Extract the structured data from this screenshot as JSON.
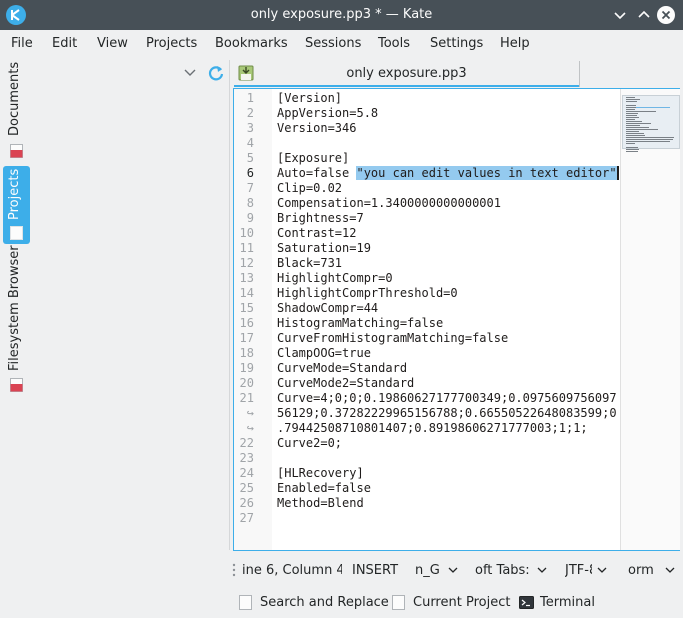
{
  "window": {
    "title": "only exposure.pp3 * — Kate"
  },
  "menu": [
    "File",
    "Edit",
    "View",
    "Projects",
    "Bookmarks",
    "Sessions",
    "Tools",
    "Settings",
    "Help"
  ],
  "sidebar": {
    "tabs": [
      {
        "label": "Documents",
        "icon": "document-icon",
        "active": false
      },
      {
        "label": "Projects",
        "icon": "project-icon",
        "active": true
      },
      {
        "label": "Filesystem Browser",
        "icon": "folder-icon",
        "active": false
      }
    ]
  },
  "document_tab": {
    "label": "only exposure.pp3",
    "icon": "save-icon"
  },
  "editor": {
    "current_line": "6",
    "lines": [
      {
        "no": "1",
        "text": "[Version]"
      },
      {
        "no": "2",
        "text": "AppVersion=5.8"
      },
      {
        "no": "3",
        "text": "Version=346"
      },
      {
        "no": "4",
        "text": ""
      },
      {
        "no": "5",
        "text": "[Exposure]"
      },
      {
        "no": "6",
        "text": "Auto=false ",
        "selected": "\"you can edit values in text editor\""
      },
      {
        "no": "7",
        "text": "Clip=0.02"
      },
      {
        "no": "8",
        "text": "Compensation=1.3400000000000001"
      },
      {
        "no": "9",
        "text": "Brightness=7"
      },
      {
        "no": "10",
        "text": "Contrast=12"
      },
      {
        "no": "11",
        "text": "Saturation=19"
      },
      {
        "no": "12",
        "text": "Black=731"
      },
      {
        "no": "13",
        "text": "HighlightCompr=0"
      },
      {
        "no": "14",
        "text": "HighlightComprThreshold=0"
      },
      {
        "no": "15",
        "text": "ShadowCompr=44"
      },
      {
        "no": "16",
        "text": "HistogramMatching=false"
      },
      {
        "no": "17",
        "text": "CurveFromHistogramMatching=false"
      },
      {
        "no": "18",
        "text": "ClampOOG=true"
      },
      {
        "no": "19",
        "text": "CurveMode=Standard"
      },
      {
        "no": "20",
        "text": "CurveMode2=Standard"
      },
      {
        "no": "21",
        "text": "Curve=4;0;0;0.19860627177700349;0.0975609756097"
      },
      {
        "no": "↪",
        "text": "56129;0.37282229965156788;0.66550522648083599;0"
      },
      {
        "no": "↪",
        "text": ".79442508710801407;0.89198606271777003;1;1;"
      },
      {
        "no": "22",
        "text": "Curve2=0;"
      },
      {
        "no": "23",
        "text": ""
      },
      {
        "no": "24",
        "text": "[HLRecovery]"
      },
      {
        "no": "25",
        "text": "Enabled=false"
      },
      {
        "no": "26",
        "text": "Method=Blend"
      },
      {
        "no": "27",
        "text": ""
      }
    ]
  },
  "statusbar": {
    "position": "ine 6, Column 4",
    "mode": "INSERT",
    "dictionary": "n_G",
    "indent": "oft Tabs:",
    "encoding": "JTF-8",
    "eol_mode": "orm"
  },
  "toolviews": [
    {
      "label": "Search and Replace",
      "icon": "search-replace-icon"
    },
    {
      "label": "Current Project",
      "icon": "project-icon"
    },
    {
      "label": "Terminal",
      "icon": "terminal-icon"
    }
  ],
  "colors": {
    "accent": "#3daee9",
    "titlebar": "#475057",
    "selection": "#94caef"
  }
}
